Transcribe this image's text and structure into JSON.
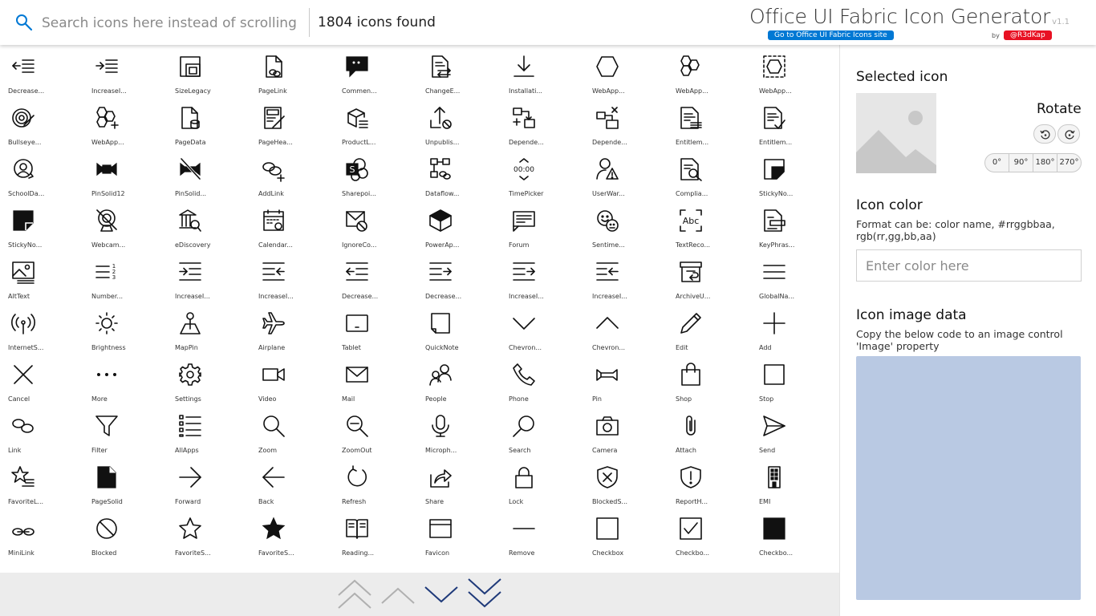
{
  "header": {
    "search_placeholder": "Search icons here instead of scrolling",
    "count_text": "1804 icons found",
    "title": "Office UI Fabric Icon Generator",
    "version": "v1.1",
    "site_link": "Go to Office UI Fabric Icons site",
    "by_label": "by",
    "author": "@R3dKap",
    "accent_color": "#0078d4",
    "author_color": "#e81123"
  },
  "icons": [
    {
      "label": "Decrease...",
      "icon": "decrease-indent-legacy"
    },
    {
      "label": "IncreaseI...",
      "icon": "increase-indent-legacy"
    },
    {
      "label": "SizeLegacy",
      "icon": "size-legacy"
    },
    {
      "label": "PageLink",
      "icon": "page-link"
    },
    {
      "label": "Commen...",
      "icon": "comment-solid"
    },
    {
      "label": "ChangeE...",
      "icon": "change-entitlements"
    },
    {
      "label": "Installati...",
      "icon": "installation"
    },
    {
      "label": "WebApp...",
      "icon": "web-app-builder-module"
    },
    {
      "label": "WebApp...",
      "icon": "web-app-builder-fragment"
    },
    {
      "label": "WebApp...",
      "icon": "web-app-builder-slot"
    },
    {
      "label": "Bullseye...",
      "icon": "bullseye-target-edit"
    },
    {
      "label": "WebApp...",
      "icon": "web-app-builder-fragment-create"
    },
    {
      "label": "PageData",
      "icon": "page-data"
    },
    {
      "label": "PageHea...",
      "icon": "page-header-edit"
    },
    {
      "label": "ProductL...",
      "icon": "product-list"
    },
    {
      "label": "Unpublis...",
      "icon": "unpublish-content"
    },
    {
      "label": "Depende...",
      "icon": "dependency-add"
    },
    {
      "label": "Depende...",
      "icon": "dependency-remove"
    },
    {
      "label": "Entitlem...",
      "icon": "entitlement-policy"
    },
    {
      "label": "Entitlem...",
      "icon": "entitlement-redemption"
    },
    {
      "label": "SchoolDa...",
      "icon": "school-data-sync-logo"
    },
    {
      "label": "PinSolid12",
      "icon": "pin-solid-12"
    },
    {
      "label": "PinSolid...",
      "icon": "pin-solid-off"
    },
    {
      "label": "AddLink",
      "icon": "add-link"
    },
    {
      "label": "Sharepoi...",
      "icon": "sharepoint-app-icon"
    },
    {
      "label": "Dataflow...",
      "icon": "dataflows-link"
    },
    {
      "label": "TimePicker",
      "icon": "time-picker"
    },
    {
      "label": "UserWar...",
      "icon": "user-warning"
    },
    {
      "label": "Complia...",
      "icon": "compliance-audit"
    },
    {
      "label": "StickyNo...",
      "icon": "sticky-notes-outline"
    },
    {
      "label": "StickyNo...",
      "icon": "sticky-notes-solid"
    },
    {
      "label": "Webcam...",
      "icon": "webcam-off"
    },
    {
      "label": "eDiscovery",
      "icon": "ediscovery"
    },
    {
      "label": "Calendar...",
      "icon": "calendar-settings"
    },
    {
      "label": "IgnoreCo...",
      "icon": "ignore-conversation"
    },
    {
      "label": "PowerAp...",
      "icon": "power-apps-logo"
    },
    {
      "label": "Forum",
      "icon": "forum"
    },
    {
      "label": "Sentime...",
      "icon": "sentiment-analysis"
    },
    {
      "label": "TextReco...",
      "icon": "text-recognition"
    },
    {
      "label": "KeyPhras...",
      "icon": "key-phrase-extraction"
    },
    {
      "label": "AltText",
      "icon": "alt-text"
    },
    {
      "label": "Number...",
      "icon": "numbered-list"
    },
    {
      "label": "IncreaseI...",
      "icon": "increase-indent-text"
    },
    {
      "label": "IncreaseI...",
      "icon": "increase-indent-arrow"
    },
    {
      "label": "Decrease...",
      "icon": "decrease-indent-text"
    },
    {
      "label": "Decrease...",
      "icon": "decrease-indent-arrow"
    },
    {
      "label": "IncreaseI...",
      "icon": "increase-indent-text-mirrored"
    },
    {
      "label": "IncreaseI...",
      "icon": "increase-indent-arrow-mirrored"
    },
    {
      "label": "ArchiveU...",
      "icon": "archive-undo"
    },
    {
      "label": "GlobalNa...",
      "icon": "global-nav-button"
    },
    {
      "label": "InternetS...",
      "icon": "internet-sharing"
    },
    {
      "label": "Brightness",
      "icon": "brightness"
    },
    {
      "label": "MapPin",
      "icon": "map-pin"
    },
    {
      "label": "Airplane",
      "icon": "airplane"
    },
    {
      "label": "Tablet",
      "icon": "tablet"
    },
    {
      "label": "QuickNote",
      "icon": "quick-note"
    },
    {
      "label": "Chevron...",
      "icon": "chevron-down"
    },
    {
      "label": "Chevron...",
      "icon": "chevron-up"
    },
    {
      "label": "Edit",
      "icon": "edit"
    },
    {
      "label": "Add",
      "icon": "add"
    },
    {
      "label": "Cancel",
      "icon": "cancel"
    },
    {
      "label": "More",
      "icon": "more"
    },
    {
      "label": "Settings",
      "icon": "settings"
    },
    {
      "label": "Video",
      "icon": "video"
    },
    {
      "label": "Mail",
      "icon": "mail"
    },
    {
      "label": "People",
      "icon": "people"
    },
    {
      "label": "Phone",
      "icon": "phone"
    },
    {
      "label": "Pin",
      "icon": "pin"
    },
    {
      "label": "Shop",
      "icon": "shop"
    },
    {
      "label": "Stop",
      "icon": "stop"
    },
    {
      "label": "Link",
      "icon": "link"
    },
    {
      "label": "Filter",
      "icon": "filter"
    },
    {
      "label": "AllApps",
      "icon": "all-apps"
    },
    {
      "label": "Zoom",
      "icon": "zoom"
    },
    {
      "label": "ZoomOut",
      "icon": "zoom-out"
    },
    {
      "label": "Microph...",
      "icon": "microphone"
    },
    {
      "label": "Search",
      "icon": "search"
    },
    {
      "label": "Camera",
      "icon": "camera"
    },
    {
      "label": "Attach",
      "icon": "attach"
    },
    {
      "label": "Send",
      "icon": "send"
    },
    {
      "label": "FavoriteL...",
      "icon": "favorite-list"
    },
    {
      "label": "PageSolid",
      "icon": "page-solid"
    },
    {
      "label": "Forward",
      "icon": "forward"
    },
    {
      "label": "Back",
      "icon": "back"
    },
    {
      "label": "Refresh",
      "icon": "refresh"
    },
    {
      "label": "Share",
      "icon": "share"
    },
    {
      "label": "Lock",
      "icon": "lock"
    },
    {
      "label": "BlockedS...",
      "icon": "blocked-site"
    },
    {
      "label": "ReportH...",
      "icon": "report-hacked"
    },
    {
      "label": "EMI",
      "icon": "emi"
    },
    {
      "label": "MiniLink",
      "icon": "mini-link"
    },
    {
      "label": "Blocked",
      "icon": "blocked"
    },
    {
      "label": "FavoriteS...",
      "icon": "favorite-star"
    },
    {
      "label": "FavoriteS...",
      "icon": "favorite-star-fill"
    },
    {
      "label": "Reading...",
      "icon": "reading-mode"
    },
    {
      "label": "Favicon",
      "icon": "favicon"
    },
    {
      "label": "Remove",
      "icon": "remove"
    },
    {
      "label": "Checkbox",
      "icon": "checkbox"
    },
    {
      "label": "Checkbo...",
      "icon": "checkbox-composite"
    },
    {
      "label": "Checkbo...",
      "icon": "checkbox-fill"
    }
  ],
  "pager": {
    "active_color": "#1f3a7a",
    "inactive_color": "#b0b0b0"
  },
  "panel": {
    "selected_title": "Selected icon",
    "rotate_label": "Rotate",
    "degrees": [
      "0°",
      "90°",
      "180°",
      "270°"
    ],
    "color_title": "Icon color",
    "color_help": "Format can be: color name, #rrggbbaa, rgb(rr,gg,bb,aa)",
    "color_placeholder": "Enter color here",
    "image_title": "Icon image data",
    "image_help": "Copy the below code to an image control 'Image' property",
    "code_bg": "#b9c9e3"
  }
}
